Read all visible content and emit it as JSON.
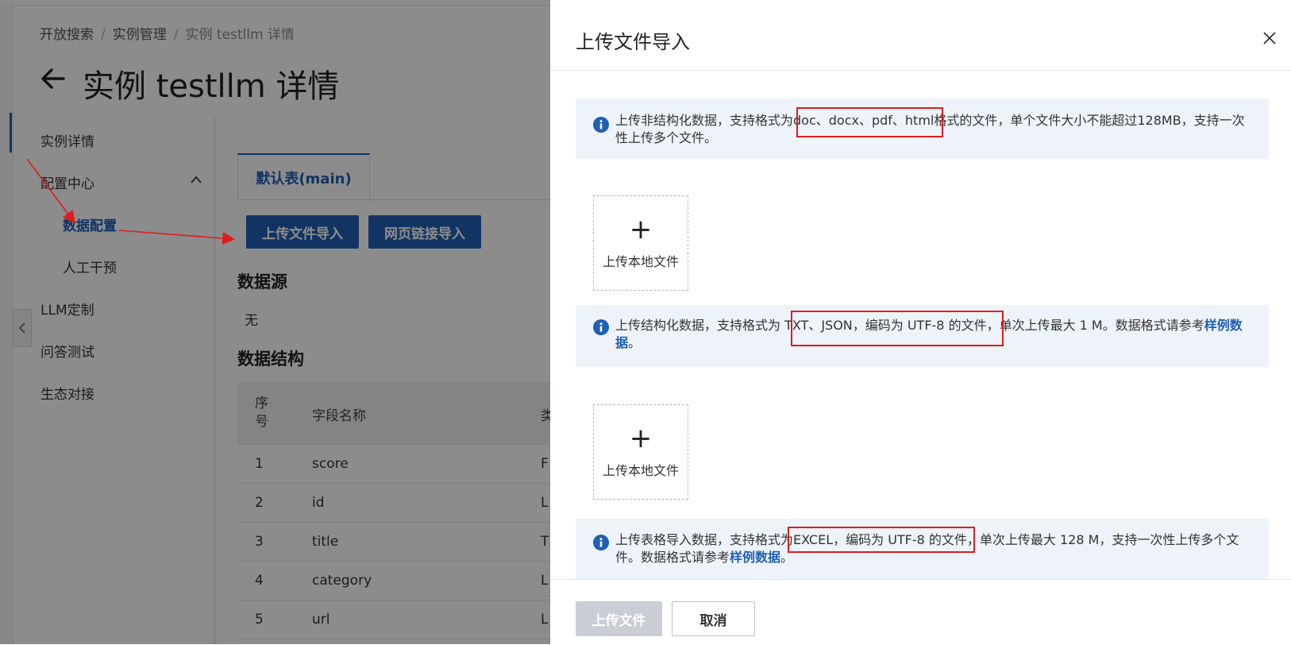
{
  "breadcrumb": [
    "开放搜索",
    "实例管理",
    "实例 testllm 详情"
  ],
  "page_title": "实例 testllm 详情",
  "sidebar": {
    "items": [
      {
        "label": "实例详情"
      },
      {
        "label": "配置中心"
      },
      {
        "label": "数据配置"
      },
      {
        "label": "人工干预"
      },
      {
        "label": "LLM定制"
      },
      {
        "label": "问答测试"
      },
      {
        "label": "生态对接"
      }
    ]
  },
  "main": {
    "tab_label": "默认表(main)",
    "buttons": {
      "upload_file": "上传文件导入",
      "web_link": "网页链接导入"
    },
    "datasource_title": "数据源",
    "datasource_value": "无",
    "structure_title": "数据结构",
    "table": {
      "headers": [
        "序\n号",
        "字段名称",
        "类"
      ],
      "rows": [
        [
          "1",
          "score",
          "F"
        ],
        [
          "2",
          "id",
          "L"
        ],
        [
          "3",
          "title",
          "T"
        ],
        [
          "4",
          "category",
          "L"
        ],
        [
          "5",
          "url",
          "L"
        ]
      ]
    }
  },
  "drawer": {
    "title": "上传文件导入",
    "notices": [
      {
        "text": "上传非结构化数据，支持格式为doc、docx、pdf、html格式的文件，单个文件大小不能超过128MB，支持一次性上传多个文件。"
      },
      {
        "text": "上传结构化数据，支持格式为 TXT、JSON，编码为 UTF-8 的文件，单次上传最大 1 M。数据格式请参考",
        "link": "样例数据",
        "suffix": "。"
      },
      {
        "text": "上传表格导入数据，支持格式为EXCEL，编码为 UTF-8 的文件，单次上传最大 128 M，支持一次性上传多个文件。数据格式请参考",
        "link": "样例数据",
        "suffix": "。"
      }
    ],
    "upload_label": "上传本地文件",
    "upload_plus": "+",
    "footer": {
      "upload": "上传文件",
      "cancel": "取消"
    }
  },
  "colors": {
    "accent": "#1f5fb5",
    "annotation": "#e21b1b",
    "notice_bg": "#eef3f9"
  }
}
